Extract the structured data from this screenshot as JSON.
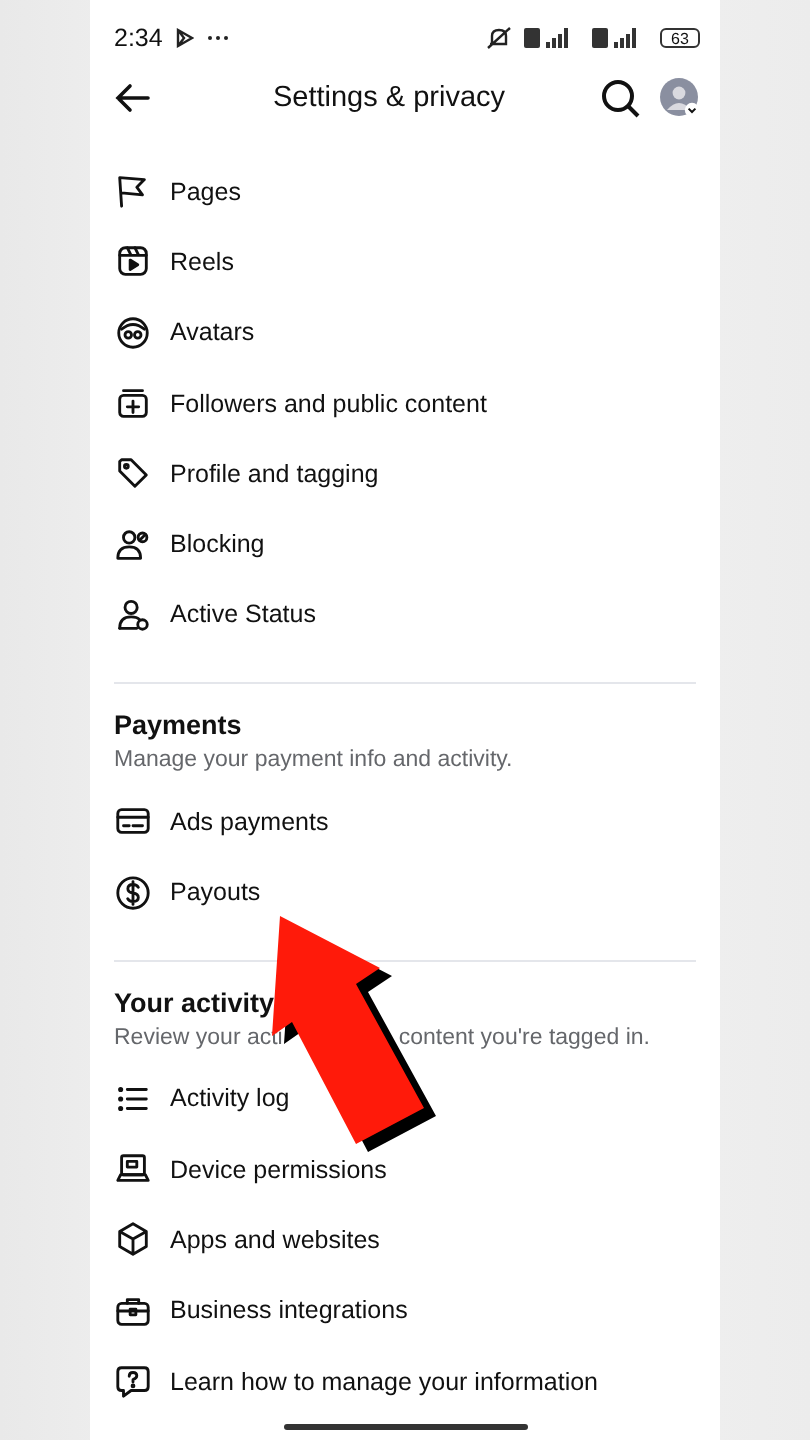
{
  "status_bar": {
    "time": "2:34",
    "battery": "63"
  },
  "header": {
    "title": "Settings & privacy"
  },
  "sections": [
    {
      "items": [
        {
          "label": "Pages"
        },
        {
          "label": "Reels"
        },
        {
          "label": "Avatars"
        },
        {
          "label": "Followers and public content"
        },
        {
          "label": "Profile and tagging"
        },
        {
          "label": "Blocking"
        },
        {
          "label": "Active Status"
        }
      ]
    },
    {
      "title": "Payments",
      "subtitle": [
        "Manage your payment info and activity."
      ],
      "items": [
        {
          "label": "Ads payments"
        },
        {
          "label": "Payouts"
        }
      ]
    },
    {
      "title": "Your activity",
      "subtitle": [
        "Review your acti",
        "content you're tagged in."
      ],
      "items": [
        {
          "label": "Activity log"
        },
        {
          "label": "Device permissions"
        },
        {
          "label": "Apps and websites"
        },
        {
          "label": "Business integrations"
        },
        {
          "label": "Learn how to manage your information"
        }
      ]
    }
  ]
}
